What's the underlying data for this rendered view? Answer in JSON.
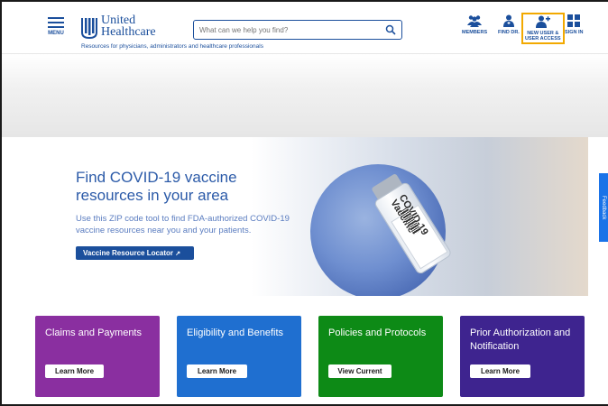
{
  "header": {
    "menu_label": "MENU",
    "logo_line1": "United",
    "logo_line2": "Healthcare",
    "tagline": "Resources for physicians, administrators and healthcare professionals",
    "search_placeholder": "What can we help you find?",
    "nav": [
      {
        "label": "MEMBERS",
        "icon": "members-icon"
      },
      {
        "label": "FIND DR.",
        "icon": "find-doctor-icon"
      },
      {
        "label_line1": "NEW USER &",
        "label_line2": "USER ACCESS",
        "icon": "add-user-icon",
        "highlighted": true
      },
      {
        "label": "SIGN IN",
        "icon": "sign-in-icon"
      }
    ]
  },
  "hero": {
    "title": "Find COVID-19 vaccine resources in your area",
    "text": "Use this ZIP code tool to find FDA-authorized COVID-19 vaccine resources near you and your patients.",
    "button_label": "Vaccine Resource Locator",
    "vial_text": "COVID-19 Vaccine"
  },
  "feedback_label": "Feedback",
  "cards": [
    {
      "title": "Claims and Payments",
      "button": "Learn More",
      "color": "#8a2fa0"
    },
    {
      "title": "Eligibility and Benefits",
      "button": "Learn More",
      "color": "#1f6fd0"
    },
    {
      "title": "Policies and Protocols",
      "button": "View Current",
      "color": "#0d8a16"
    },
    {
      "title": "Prior Authorization and Notification",
      "button": "Learn More",
      "color": "#3e248f"
    }
  ],
  "colors": {
    "brand_blue": "#1b4f9c",
    "highlight": "#f2a900",
    "feedback": "#1a73e8"
  }
}
